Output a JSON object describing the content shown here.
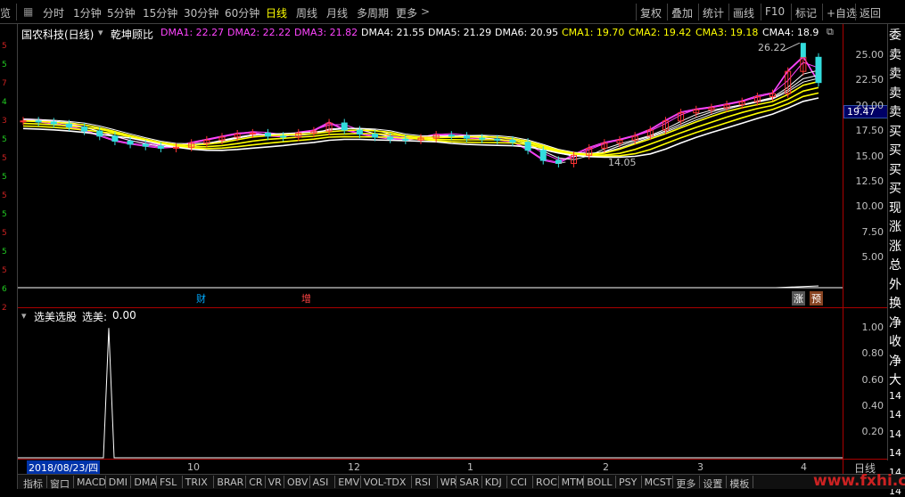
{
  "topbar": {
    "left_cut": "览",
    "periods": [
      "分时",
      "1分钟",
      "5分钟",
      "15分钟",
      "30分钟",
      "60分钟",
      "日线",
      "周线",
      "月线",
      "多周期",
      "更多"
    ],
    "active_period": "日线",
    "more_icon": "chevron-right",
    "right": [
      "复权",
      "叠加",
      "统计",
      "画线",
      "F10",
      "标记",
      "+自选",
      "返回"
    ]
  },
  "chart": {
    "title": "国农科技(日线)",
    "indicator": "乾坤顾比",
    "ma_values": [
      {
        "label": "DMA1:",
        "value": "22.27",
        "color": "#ff44ff"
      },
      {
        "label": "DMA2:",
        "value": "22.22",
        "color": "#ff44ff"
      },
      {
        "label": "DMA3:",
        "value": "21.82",
        "color": "#ff44ff"
      },
      {
        "label": "DMA4:",
        "value": "21.55",
        "color": "#ffffff"
      },
      {
        "label": "DMA5:",
        "value": "21.29",
        "color": "#ffffff"
      },
      {
        "label": "DMA6:",
        "value": "20.95",
        "color": "#ffffff"
      },
      {
        "label": "CMA1:",
        "value": "19.70",
        "color": "#ffff00"
      },
      {
        "label": "CMA2:",
        "value": "19.42",
        "color": "#ffff00"
      },
      {
        "label": "CMA3:",
        "value": "19.18",
        "color": "#ffff00"
      },
      {
        "label": "CMA4:",
        "value": "18.9",
        "color": "#ffffff"
      }
    ],
    "price_ticks": [
      "25.00",
      "22.50",
      "20.00",
      "17.50",
      "15.00",
      "12.50",
      "10.00",
      "7.50",
      "5.00"
    ],
    "current_price": "19.47",
    "high_note": "26.22",
    "low_note": "14.05",
    "event_notes": [
      {
        "text": "财",
        "color": "#00aaff"
      },
      {
        "text": "增",
        "color": "#ff4444"
      },
      {
        "text": "涨",
        "color": "#ffffff"
      },
      {
        "text": "预",
        "color": "#ffffff"
      }
    ]
  },
  "indicator_panel": {
    "title": "选美选股",
    "label": "选美:",
    "value": "0.00",
    "ticks": [
      "1.00",
      "0.80",
      "0.60",
      "0.40",
      "0.20"
    ],
    "spike_value": 1.0
  },
  "date_axis": {
    "cursor_date": "2018/08/23/四",
    "labels": [
      "10",
      "12",
      "1",
      "2",
      "3",
      "4"
    ]
  },
  "period_cell": "日线",
  "right_strip": [
    "委",
    "卖",
    "卖",
    "卖",
    "卖",
    "买",
    "买",
    "买",
    "买",
    "现",
    "涨",
    "涨",
    "总",
    "外",
    "换",
    "净",
    "收",
    "净",
    "大",
    "14",
    "14",
    "14",
    "14",
    "14",
    "14"
  ],
  "left_strip": [
    "5",
    "5",
    "7",
    "4",
    "3",
    "5",
    "5",
    "5",
    "5",
    "5",
    "5",
    "5",
    "5",
    "6",
    "2"
  ],
  "bottombar": {
    "items": [
      "指标",
      "窗口",
      "MACD",
      "DMI",
      "DMA",
      "FSL",
      "TRIX",
      "BRAR",
      "CR",
      "VR",
      "OBV",
      "ASI",
      "EMV",
      "VOL-TDX",
      "RSI",
      "WR",
      "SAR",
      "KDJ",
      "CCI",
      "ROC",
      "MTM",
      "BOLL",
      "PSY",
      "MCST",
      "更多",
      "设置",
      "模板"
    ]
  },
  "watermark": "www.fxhi.com",
  "chart_data": {
    "type": "candlestick",
    "title": "国农科技(日线)",
    "ylim": [
      5,
      26.5
    ],
    "y_ticks": [
      5,
      7.5,
      10,
      12.5,
      15,
      17.5,
      20,
      22.5,
      25
    ],
    "x_labels": [
      "2018/08/23",
      "10",
      "12",
      "1",
      "2",
      "3",
      "4"
    ],
    "series": [
      {
        "name": "DMA1",
        "last": 22.27
      },
      {
        "name": "DMA2",
        "last": 22.22
      },
      {
        "name": "DMA3",
        "last": 21.82
      },
      {
        "name": "DMA4",
        "last": 21.55
      },
      {
        "name": "DMA5",
        "last": 21.29
      },
      {
        "name": "DMA6",
        "last": 20.95
      },
      {
        "name": "CMA1",
        "last": 19.7
      },
      {
        "name": "CMA2",
        "last": 19.42
      },
      {
        "name": "CMA3",
        "last": 19.18
      },
      {
        "name": "CMA4",
        "last": 18.9
      }
    ],
    "close_path": [
      18.5,
      18.4,
      18.2,
      17.9,
      17.5,
      17.0,
      16.5,
      16.2,
      16.0,
      15.8,
      15.9,
      16.3,
      16.6,
      16.9,
      17.2,
      17.3,
      17.0,
      16.9,
      17.3,
      17.5,
      18.3,
      17.6,
      17.2,
      16.9,
      16.7,
      16.6,
      16.8,
      17.1,
      17.0,
      16.8,
      16.7,
      16.6,
      16.4,
      15.6,
      14.6,
      14.3,
      15.1,
      15.8,
      16.3,
      16.6,
      17.0,
      17.6,
      18.5,
      19.3,
      19.6,
      19.8,
      20.1,
      20.4,
      20.9,
      21.2,
      23.4,
      24.8,
      22.3
    ],
    "high": 26.22,
    "low": 14.05,
    "last": 19.47,
    "indicator": {
      "name": "选美",
      "values_nonzero": [
        {
          "x": "2018-09",
          "value": 1.0
        }
      ],
      "ylim": [
        0,
        1.05
      ]
    }
  }
}
